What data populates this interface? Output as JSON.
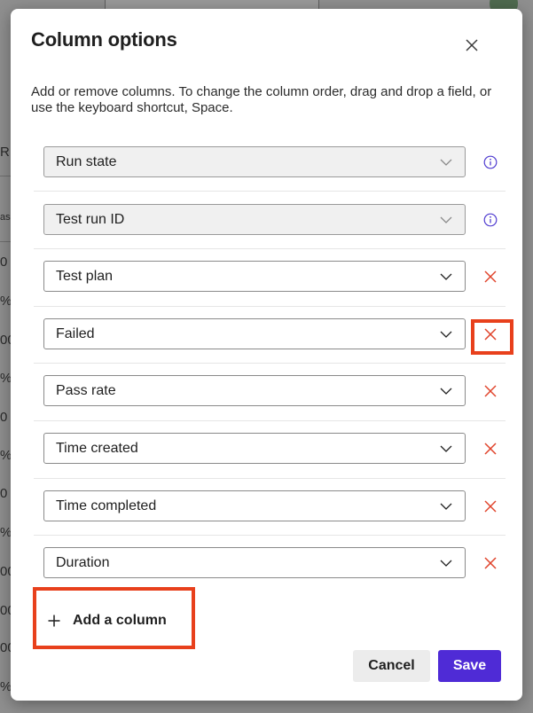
{
  "background": {
    "fragments": [
      "R",
      "as",
      "0",
      "%",
      "00",
      "%",
      "0",
      "%",
      "0",
      "%",
      "00",
      "00",
      "00",
      "%",
      "%"
    ]
  },
  "dialog": {
    "title": "Column options",
    "description": "Add or remove columns. To change the column order, drag and drop a field, or use the keyboard shortcut, Space.",
    "rows": [
      {
        "label": "Run state",
        "locked": true,
        "action_icon": "info-icon"
      },
      {
        "label": "Test run ID",
        "locked": true,
        "action_icon": "info-icon"
      },
      {
        "label": "Test plan",
        "locked": false,
        "action_icon": "remove-icon"
      },
      {
        "label": "Failed",
        "locked": false,
        "action_icon": "remove-icon",
        "highlighted": true
      },
      {
        "label": "Pass rate",
        "locked": false,
        "action_icon": "remove-icon"
      },
      {
        "label": "Time created",
        "locked": false,
        "action_icon": "remove-icon"
      },
      {
        "label": "Time completed",
        "locked": false,
        "action_icon": "remove-icon"
      },
      {
        "label": "Duration",
        "locked": false,
        "action_icon": "remove-icon"
      }
    ],
    "add_column_label": "Add a column",
    "cancel_label": "Cancel",
    "save_label": "Save"
  },
  "colors": {
    "accent": "#4f2bd6",
    "info": "#4f3bd0",
    "remove": "#e0442c",
    "highlight": "#e8401c"
  }
}
